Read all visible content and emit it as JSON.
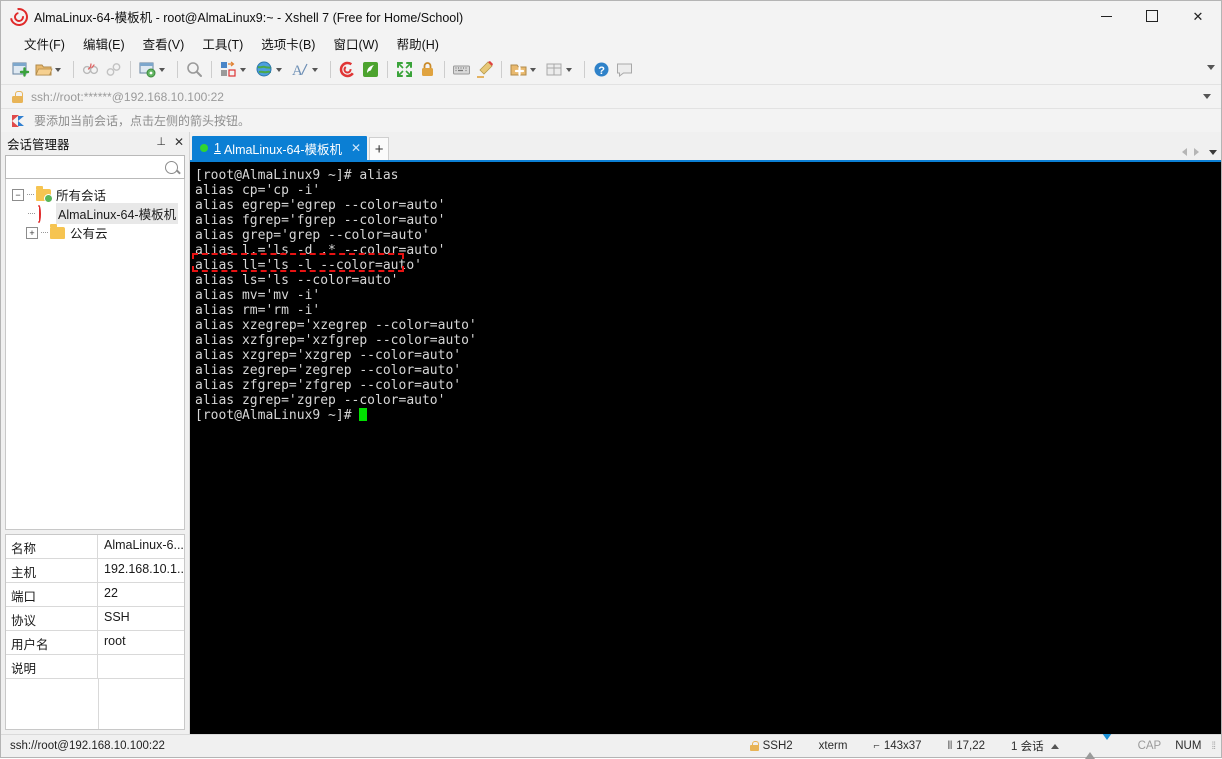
{
  "window": {
    "title": "AlmaLinux-64-模板机 - root@AlmaLinux9:~ - Xshell 7 (Free for Home/School)",
    "app_icon": "xshell-spiral-icon",
    "minimize_label": "—",
    "maximize_label": "□",
    "close_label": "✕"
  },
  "menubar": {
    "items": [
      {
        "label": "文件(F)",
        "name": "menu-file"
      },
      {
        "label": "编辑(E)",
        "name": "menu-edit"
      },
      {
        "label": "查看(V)",
        "name": "menu-view"
      },
      {
        "label": "工具(T)",
        "name": "menu-tools"
      },
      {
        "label": "选项卡(B)",
        "name": "menu-tabs"
      },
      {
        "label": "窗口(W)",
        "name": "menu-window"
      },
      {
        "label": "帮助(H)",
        "name": "menu-help"
      }
    ]
  },
  "toolbar": {
    "icons": [
      "new-session-icon",
      "open-folder-icon",
      "disconnect-icon",
      "reconnect-icon",
      "session-properties-icon",
      "find-icon",
      "copy-paste-icon",
      "globe-icon",
      "font-icon",
      "xshell-icon",
      "xftp-icon",
      "fullscreen-icon",
      "lock-icon",
      "keyboard-icon",
      "highlight-icon",
      "add-panel-icon",
      "layout-icon",
      "help-icon",
      "comment-icon"
    ],
    "overflow_label": "▾"
  },
  "addressbar": {
    "lock_icon": "lock-icon",
    "value": "ssh://root:******@192.168.10.100:22",
    "dropdown_label": "▾"
  },
  "notice": {
    "icon": "flag-icon",
    "text": "要添加当前会话，点击左侧的箭头按钮。"
  },
  "sidebar": {
    "title": "会话管理器",
    "pin_label": "⊥",
    "close_label": "✕",
    "search": {
      "value": "",
      "placeholder": "",
      "icon": "search-icon"
    },
    "tree": [
      {
        "label": "所有会话",
        "expander": "−",
        "icon": "folder-settings-icon",
        "level": 0,
        "selected": false
      },
      {
        "label": "AlmaLinux-64-模板机",
        "expander": "",
        "icon": "session-icon",
        "level": 1,
        "selected": true
      },
      {
        "label": "公有云",
        "expander": "+",
        "icon": "folder-icon",
        "level": 0,
        "selected": false
      }
    ],
    "properties": [
      {
        "key": "名称",
        "value": "AlmaLinux-6..."
      },
      {
        "key": "主机",
        "value": "192.168.10.1..."
      },
      {
        "key": "端口",
        "value": "22"
      },
      {
        "key": "协议",
        "value": "SSH"
      },
      {
        "key": "用户名",
        "value": "root"
      },
      {
        "key": "说明",
        "value": ""
      }
    ]
  },
  "tabs": {
    "items": [
      {
        "number": "1",
        "label": "AlmaLinux-64-模板机",
        "status_dot": "connected-dot",
        "close_label": "✕",
        "active": true
      }
    ],
    "new_tab_label": "+",
    "scroll_left_label": "◀",
    "scroll_right_label": "▶",
    "tab_menu_label": "▾"
  },
  "terminal": {
    "background": "#000000",
    "foreground": "#d6d6d6",
    "cursor_color": "#00e000",
    "annotation_color": "#e81313",
    "lines": [
      "[root@AlmaLinux9 ~]# alias",
      "alias cp='cp -i'",
      "alias egrep='egrep --color=auto'",
      "alias fgrep='fgrep --color=auto'",
      "alias grep='grep --color=auto'",
      "alias l.='ls -d .* --color=auto'",
      "alias ll='ls -l --color=auto'",
      "alias ls='ls --color=auto'",
      "alias mv='mv -i'",
      "alias rm='rm -i'",
      "alias xzegrep='xzegrep --color=auto'",
      "alias xzfgrep='xzfgrep --color=auto'",
      "alias xzgrep='xzgrep --color=auto'",
      "alias zegrep='zegrep --color=auto'",
      "alias zfgrep='zfgrep --color=auto'",
      "alias zgrep='zgrep --color=auto'"
    ],
    "prompt": "[root@AlmaLinux9 ~]# ",
    "annotated_line_index": 6
  },
  "statusbar": {
    "connection": "ssh://root@192.168.10.100:22",
    "security": "SSH2",
    "term_type": "xterm",
    "size": "143x37",
    "cursor_pos": "17,22",
    "sessions": "1 会话",
    "caps": "CAP",
    "num": "NUM"
  }
}
